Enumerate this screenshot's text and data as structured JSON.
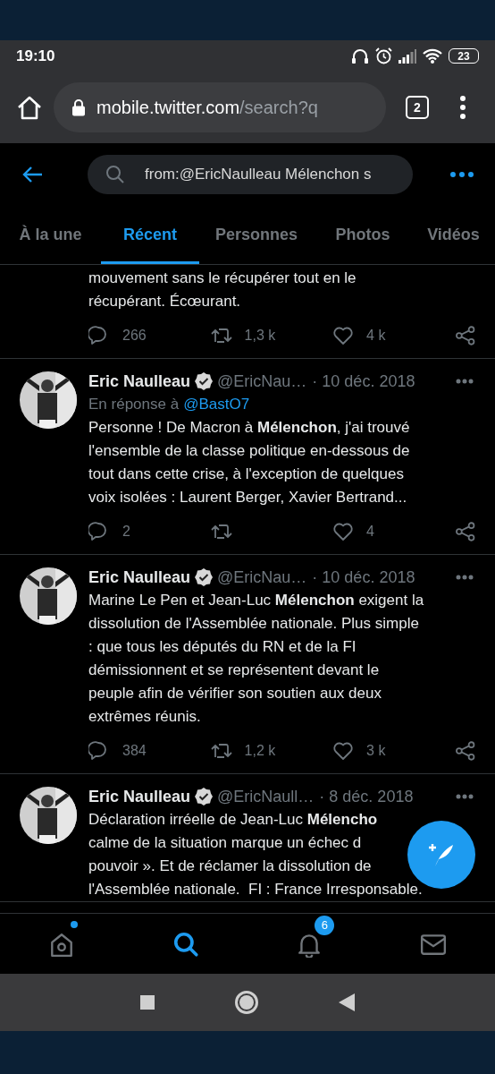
{
  "status_bar": {
    "time": "19:10",
    "battery": "23"
  },
  "browser": {
    "url_host": "mobile.twitter.com",
    "url_path": "/search?q",
    "tab_count": "2"
  },
  "search": {
    "value": "from:@EricNaulleau Mélenchon s"
  },
  "tabs": [
    {
      "label": "À la une",
      "selected": false
    },
    {
      "label": "Récent",
      "selected": true
    },
    {
      "label": "Personnes",
      "selected": false
    },
    {
      "label": "Photos",
      "selected": false
    },
    {
      "label": "Vidéos",
      "selected": false
    }
  ],
  "tweets": [
    {
      "partial": true,
      "lines": [
        "mouvement sans le récupérer tout en le",
        "récupérant. Écœurant."
      ],
      "replies": "266",
      "retweets": "1,3 k",
      "likes": "4 k"
    },
    {
      "name": "Eric Naulleau",
      "handle": "@EricNau…",
      "date": "· 10 déc. 2018",
      "reply_to_label": "En réponse à",
      "reply_to": "@BastO7",
      "lines": [
        "Personne ! De Macron à **Mélenchon**, j'ai trouvé",
        "l'ensemble de la classe politique en-dessous de",
        "tout dans cette crise, à l'exception de quelques",
        "voix isolées : Laurent Berger, Xavier Bertrand..."
      ],
      "replies": "2",
      "likes": "4"
    },
    {
      "name": "Eric Naulleau",
      "handle": "@EricNau…",
      "date": "· 10 déc. 2018",
      "lines": [
        "Marine Le Pen et Jean-Luc **Mélenchon** exigent la",
        "dissolution de l'Assemblée nationale. Plus simple",
        ": que tous les députés du RN et de la FI",
        "démissionnent et se représentent devant le",
        "peuple afin de vérifier son soutien aux deux",
        "extrêmes réunis."
      ],
      "replies": "384",
      "retweets": "1,2 k",
      "likes": "3 k"
    },
    {
      "name": "Eric Naulleau",
      "handle": "@EricNaull…",
      "date": "· 8 déc. 2018",
      "lines": [
        "Déclaration irréelle de Jean-Luc **Mélencho**",
        "calme de la situation marque un échec d",
        "pouvoir ». Et de réclamer la dissolution de",
        "l'Assemblée nationale.  FI : France Irresponsable."
      ]
    }
  ],
  "bottom_nav": [
    {
      "kind": "home",
      "selected": false,
      "dot": true
    },
    {
      "kind": "search",
      "selected": true
    },
    {
      "kind": "notifications",
      "selected": false,
      "badge": "6"
    },
    {
      "kind": "messages",
      "selected": false
    }
  ]
}
